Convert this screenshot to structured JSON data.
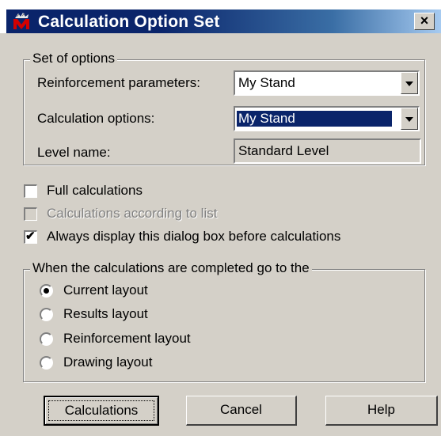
{
  "window": {
    "title": "Calculation Option Set",
    "close_symbol": "×",
    "app_icon": "robot-m-icon"
  },
  "set_of_options": {
    "title": "Set of options",
    "reinforcement_label": "Reinforcement parameters:",
    "reinforcement_value": "My Stand",
    "calc_options_label": "Calculation options:",
    "calc_options_value": "My Stand",
    "level_label": "Level name:",
    "level_value": "Standard Level"
  },
  "checkboxes": [
    {
      "label": "Full calculations",
      "checked": false,
      "enabled": true
    },
    {
      "label": "Calculations according to list",
      "checked": false,
      "enabled": false
    },
    {
      "label": "Always display this dialog box before calculations",
      "checked": true,
      "enabled": true
    }
  ],
  "goto_group": {
    "title": "When the calculations are completed go to the",
    "options": [
      "Current layout",
      "Results layout",
      "Reinforcement layout",
      "Drawing layout"
    ],
    "selected": "Current layout"
  },
  "buttons": {
    "calculations": "Calculations",
    "cancel": "Cancel",
    "help": "Help"
  },
  "check_mark": "✔"
}
